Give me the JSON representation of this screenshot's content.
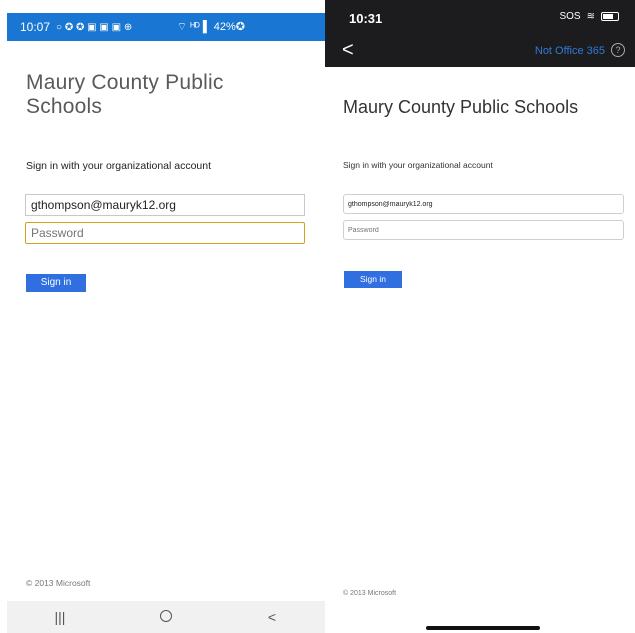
{
  "android": {
    "status": {
      "time": "10:07",
      "icons_left": "○ ✪ ✪ ▣ ▣ ▣ ⊕",
      "icons_right": "⌔ ᴴᴰ ▌ 42%✪"
    },
    "title": "Maury County Public Schools",
    "signin_label": "Sign in with your organizational account",
    "username_value": "gthompson@mauryk12.org",
    "password_placeholder": "Password",
    "signin_button": "Sign in",
    "copyright": "© 2013 Microsoft",
    "nav": {
      "recent": "|||",
      "back": "<"
    }
  },
  "ios": {
    "status": {
      "time": "10:31",
      "sos": "SOS",
      "wifi": "≋"
    },
    "back_glyph": "<",
    "not_office_365": "Not Office 365",
    "help_glyph": "?",
    "title": "Maury County Public Schools",
    "signin_label": "Sign in with your organizational account",
    "username_value": "gthompson@mauryk12.org",
    "password_placeholder": "Password",
    "signin_button": "Sign in",
    "copyright": "© 2013 Microsoft"
  },
  "colors": {
    "android_status": "#1976d2",
    "button": "#2f6fe0",
    "focus_border": "#d7a21c",
    "ios_topbar": "#1c1c1e",
    "link": "#2e7ad8"
  }
}
